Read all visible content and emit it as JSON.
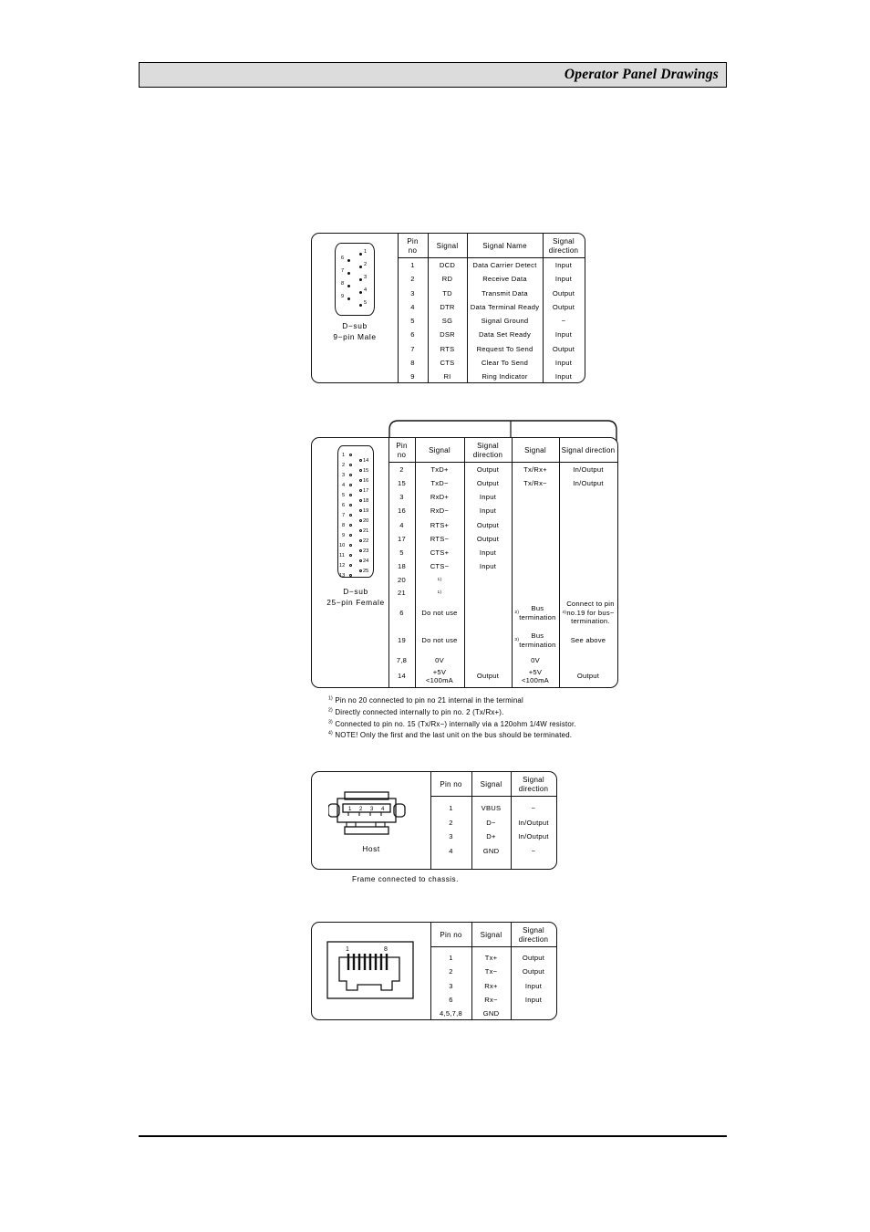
{
  "header": {
    "title": "Operator Panel Drawings"
  },
  "fig_dsub9": {
    "connector_label": "D−sub\n9−pin Male",
    "columns": [
      "Pin\nno",
      "Signal",
      "Signal Name",
      "Signal direction"
    ],
    "rows": [
      [
        "1",
        "DCD",
        "Data Carrier Detect",
        "Input"
      ],
      [
        "2",
        "RD",
        "Receive Data",
        "Input"
      ],
      [
        "3",
        "TD",
        "Transmit Data",
        "Output"
      ],
      [
        "4",
        "DTR",
        "Data Terminal Ready",
        "Output"
      ],
      [
        "5",
        "SG",
        "Signal Ground",
        "−"
      ],
      [
        "6",
        "DSR",
        "Data Set Ready",
        "Input"
      ],
      [
        "7",
        "RTS",
        "Request To Send",
        "Output"
      ],
      [
        "8",
        "CTS",
        "Clear To Send",
        "Input"
      ],
      [
        "9",
        "RI",
        "Ring Indicator",
        "Input"
      ]
    ]
  },
  "fig_dsub25": {
    "connector_label": "D−sub\n25−pin Female",
    "columns": [
      "Pin\nno",
      "Signal",
      "Signal direction",
      "Signal",
      "Signal direction"
    ],
    "rows": [
      [
        "2",
        "TxD+",
        "Output",
        "Tx/Rx+",
        "In/Output"
      ],
      [
        "15",
        "TxD−",
        "Output",
        "Tx/Rx−",
        "In/Output"
      ],
      [
        "3",
        "RxD+",
        "Input",
        "",
        ""
      ],
      [
        "16",
        "RxD−",
        "Input",
        "",
        ""
      ],
      [
        "4",
        "RTS+",
        "Output",
        "",
        ""
      ],
      [
        "17",
        "RTS−",
        "Output",
        "",
        ""
      ],
      [
        "5",
        "CTS+",
        "Input",
        "",
        ""
      ],
      [
        "18",
        "CTS−",
        "Input",
        "",
        ""
      ],
      [
        "20",
        "1)",
        "",
        "",
        ""
      ],
      [
        "21",
        "1)",
        "",
        "",
        ""
      ],
      [
        "6",
        "Do not use",
        "",
        "2) Bus\ntermination",
        "4) Connect to pin\nno.19 for bus−\ntermination."
      ],
      [
        "19",
        "Do not use",
        "",
        "3) Bus\ntermination",
        "See above"
      ],
      [
        "7,8",
        "0V",
        "",
        "0V",
        ""
      ],
      [
        "14",
        "+5V\n<100mA",
        "Output",
        "+5V\n<100mA",
        "Output"
      ]
    ],
    "notes": [
      "1) Pin no 20 connected to pin no 21 internal in the terminal",
      "2) Directly connected internally to pin no. 2 (Tx/Rx+).",
      "3) Connected to pin no. 15 (Tx/Rx−) internally via a 120ohm 1/4W resistor.",
      "4) NOTE! Only the first and the last unit on the bus should be terminated."
    ]
  },
  "fig_usb": {
    "connector_label": "Host",
    "columns": [
      "Pin no",
      "Signal",
      "Signal direction"
    ],
    "rows": [
      [
        "1",
        "VBUS",
        "−"
      ],
      [
        "2",
        "D−",
        "In/Output"
      ],
      [
        "3",
        "D+",
        "In/Output"
      ],
      [
        "4",
        "GND",
        "−"
      ]
    ],
    "caption": "Frame connected to chassis."
  },
  "fig_rj45": {
    "pin_first": "1",
    "pin_last": "8",
    "columns": [
      "Pin no",
      "Signal",
      "Signal direction"
    ],
    "rows": [
      [
        "1",
        "Tx+",
        "Output"
      ],
      [
        "2",
        "Tx−",
        "Output"
      ],
      [
        "3",
        "Rx+",
        "Input"
      ],
      [
        "6",
        "Rx−",
        "Input"
      ],
      [
        "4,5,7,8",
        "GND",
        ""
      ]
    ]
  }
}
